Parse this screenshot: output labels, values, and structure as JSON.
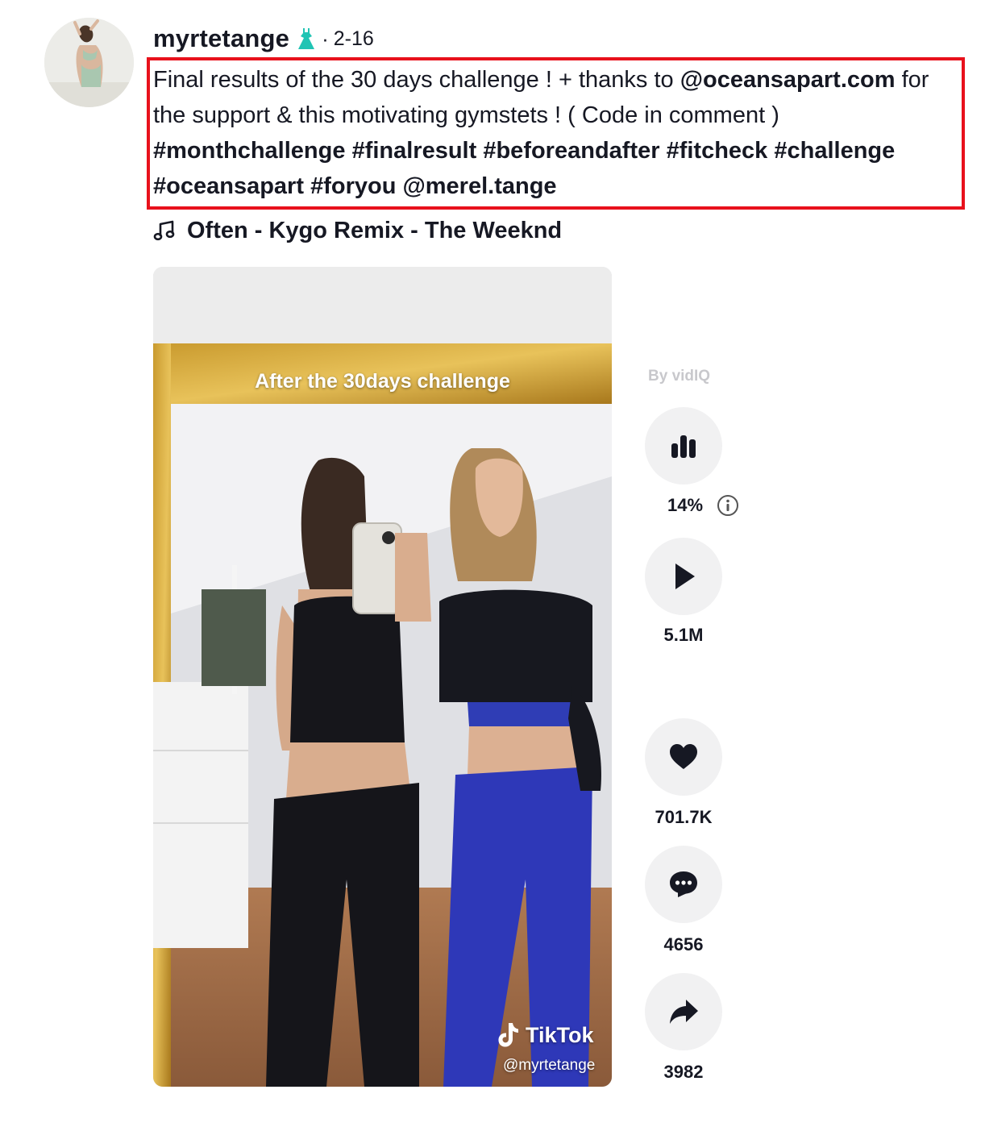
{
  "post": {
    "username": "myrtetange",
    "badge_icon": "dress-icon",
    "separator": "·",
    "date": "2-16"
  },
  "caption": {
    "text_1": "Final results of the 30 days challenge ! + thanks to ",
    "mention_1": "@oceansapart.com",
    "text_2": " for the support & this motivating gymstets ! ( Code in comment ) ",
    "hashtags": [
      "#monthchallenge",
      "#finalresult",
      "#beforeandafter",
      "#fitcheck",
      "#challenge",
      "#oceansapart",
      "#foryou"
    ],
    "mention_2": "@merel.tange",
    "highlight_color": "#e8111c"
  },
  "music": {
    "icon": "music-note-icon",
    "title": "Often - Kygo Remix - The Weeknd"
  },
  "video": {
    "overlay_text": "After the 30days challenge",
    "watermark_brand": "TikTok",
    "watermark_handle": "@myrtetange"
  },
  "sidebar": {
    "vidiq_label": "By vidIQ",
    "stats_icon": "bar-chart-icon",
    "engagement": "14%",
    "info_icon": "info-icon",
    "views_icon": "play-icon",
    "views": "5.1M",
    "likes_icon": "heart-icon",
    "likes": "701.7K",
    "comments_icon": "comment-icon",
    "comments": "4656",
    "shares_icon": "share-icon",
    "shares": "3982"
  }
}
